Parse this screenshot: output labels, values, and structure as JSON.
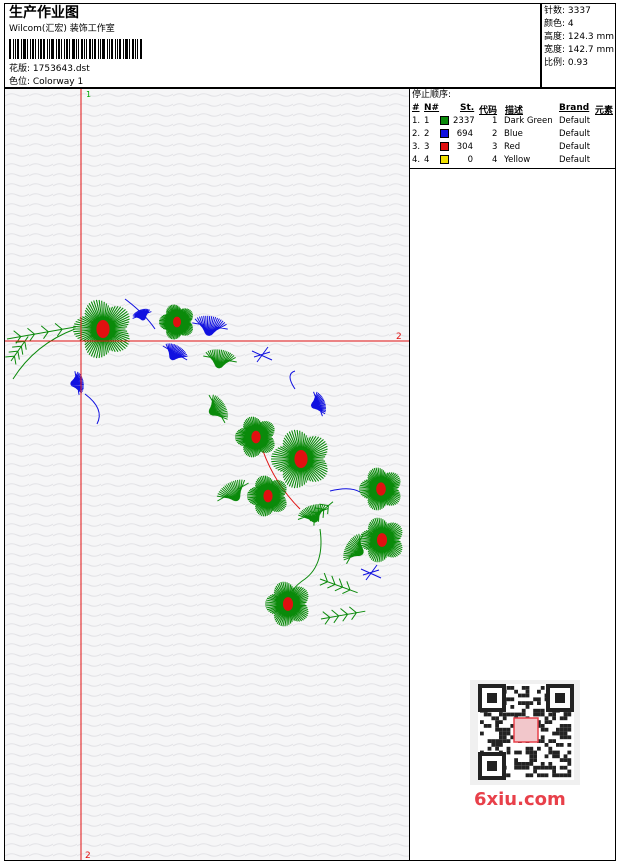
{
  "header": {
    "title": "生产作业图",
    "studio": "Wilcom(汇宏) 装饰工作室",
    "design_file": "花版: 1753643.dst",
    "colorway": "色位: Colorway 1"
  },
  "stats": [
    {
      "label": "针数: 3337"
    },
    {
      "label": "颜色: 4"
    },
    {
      "label": "高度: 124.3 mm"
    },
    {
      "label": "宽度: 142.7 mm"
    },
    {
      "label": "比例: 0.93"
    }
  ],
  "canvas": {
    "marker_top": "1",
    "marker_right": "2",
    "marker_bottom": "2"
  },
  "stop_sequence": {
    "title": "停止顺序:",
    "headers": {
      "num": "#",
      "needle": "N#",
      "stitches": "St.",
      "code": "代码",
      "desc": "描述",
      "brand": "Brand",
      "element": "元素"
    },
    "rows": [
      {
        "num": "1.",
        "needle": "1",
        "color": "#0a8a0a",
        "stitches": "2337",
        "code": "1",
        "desc": "Dark Green",
        "brand": "Default"
      },
      {
        "num": "2.",
        "needle": "2",
        "color": "#1010e0",
        "stitches": "694",
        "code": "2",
        "desc": "Blue",
        "brand": "Default"
      },
      {
        "num": "3.",
        "needle": "3",
        "color": "#e01010",
        "stitches": "304",
        "code": "3",
        "desc": "Red",
        "brand": "Default"
      },
      {
        "num": "4.",
        "needle": "4",
        "color": "#f0e000",
        "stitches": "0",
        "code": "4",
        "desc": "Yellow",
        "brand": "Default"
      }
    ]
  },
  "watermark": "6xiu.com",
  "colors": {
    "green": "#0a8a0a",
    "blue": "#1010e0",
    "red": "#e01010",
    "guide": "#e01010"
  }
}
